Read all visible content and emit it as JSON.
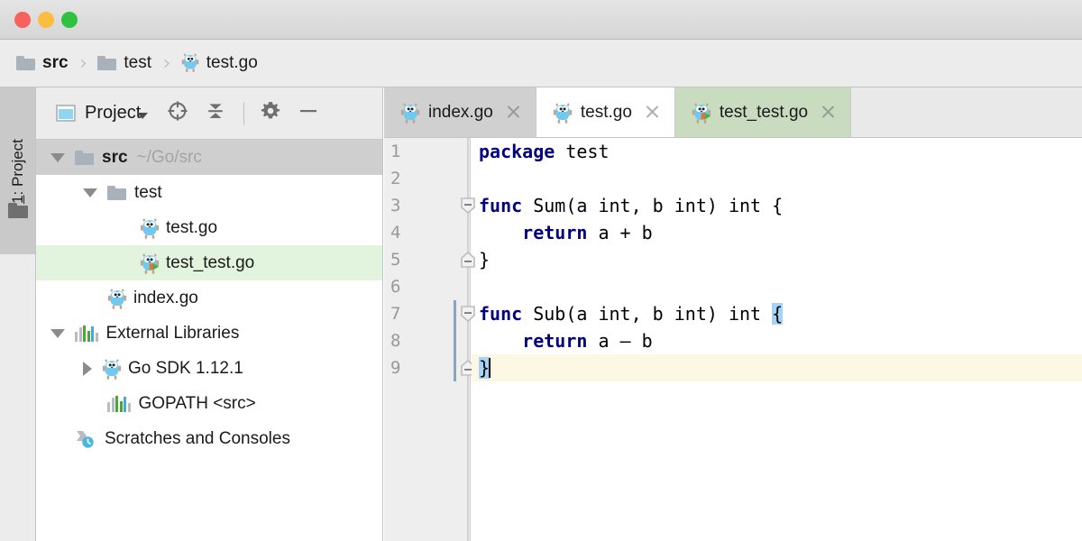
{
  "window": {
    "traffic_lights": [
      {
        "name": "close",
        "color": "#f9625c"
      },
      {
        "name": "minimize",
        "color": "#fcbc40"
      },
      {
        "name": "zoom",
        "color": "#2fc13f"
      }
    ]
  },
  "breadcrumb": {
    "items": [
      {
        "label": "src",
        "icon": "folder-icon",
        "bold": true
      },
      {
        "label": "test",
        "icon": "folder-icon",
        "bold": false
      },
      {
        "label": "test.go",
        "icon": "go-file-icon",
        "bold": false
      }
    ],
    "separator": "›"
  },
  "toolstrip": {
    "project_tab": {
      "number": "1",
      "label": "Project",
      "full": "1: Project"
    },
    "folder_icon": "folder-icon"
  },
  "project_panel": {
    "title": "Project",
    "title_icon": "project-view-icon",
    "caret": "chevron-down-icon",
    "tools": [
      {
        "name": "scroll-from-source-icon",
        "title": "Select Opened File"
      },
      {
        "name": "collapse-all-icon",
        "title": "Collapse All"
      },
      {
        "name": "settings-gear-icon",
        "title": "Settings"
      },
      {
        "name": "hide-panel-icon",
        "title": "Hide"
      }
    ],
    "tree": [
      {
        "label": "src",
        "secondary": "~/Go/src",
        "icon": "folder-icon",
        "twisty": "down",
        "indent": 0,
        "bold": true,
        "highlight": "gray"
      },
      {
        "label": "test",
        "secondary": "",
        "icon": "folder-icon",
        "twisty": "down",
        "indent": 1,
        "bold": false,
        "highlight": "none"
      },
      {
        "label": "test.go",
        "secondary": "",
        "icon": "go-file-icon",
        "twisty": "none",
        "indent": 2,
        "bold": false,
        "highlight": "none"
      },
      {
        "label": "test_test.go",
        "secondary": "",
        "icon": "go-test-file-icon",
        "twisty": "none",
        "indent": 2,
        "bold": false,
        "highlight": "green"
      },
      {
        "label": "index.go",
        "secondary": "",
        "icon": "go-file-icon",
        "twisty": "none",
        "indent": 1,
        "bold": false,
        "highlight": "none"
      },
      {
        "label": "External Libraries",
        "secondary": "",
        "icon": "libraries-icon",
        "twisty": "down",
        "indent": 0,
        "bold": false,
        "highlight": "none"
      },
      {
        "label": "Go SDK 1.12.1",
        "secondary": "",
        "icon": "go-file-icon",
        "twisty": "right",
        "indent": 1,
        "bold": false,
        "highlight": "none"
      },
      {
        "label": "GOPATH <src>",
        "secondary": "",
        "icon": "libraries-icon",
        "twisty": "none",
        "indent": 1,
        "bold": false,
        "highlight": "none"
      },
      {
        "label": "Scratches and Consoles",
        "secondary": "",
        "icon": "scratches-icon",
        "twisty": "none",
        "indent": 0,
        "bold": false,
        "highlight": "none"
      }
    ]
  },
  "editor": {
    "tabs": [
      {
        "label": "index.go",
        "icon": "go-file-icon",
        "state": "inactive",
        "closable": true
      },
      {
        "label": "test.go",
        "icon": "go-file-icon",
        "state": "active",
        "closable": true
      },
      {
        "label": "test_test.go",
        "icon": "go-test-file-icon",
        "state": "green",
        "closable": true
      }
    ],
    "line_numbers": [
      "1",
      "2",
      "3",
      "4",
      "5",
      "6",
      "7",
      "8",
      "9"
    ],
    "lines": [
      {
        "n": "1",
        "tokens": [
          {
            "t": "package",
            "k": true
          },
          {
            "t": " test",
            "k": false
          }
        ],
        "current": false
      },
      {
        "n": "2",
        "tokens": [
          {
            "t": "",
            "k": false
          }
        ],
        "current": false
      },
      {
        "n": "3",
        "tokens": [
          {
            "t": "func",
            "k": true
          },
          {
            "t": " Sum(a int, b int) int {",
            "k": false
          }
        ],
        "current": false
      },
      {
        "n": "4",
        "tokens": [
          {
            "t": "    ",
            "k": false
          },
          {
            "t": "return",
            "k": true
          },
          {
            "t": " a + b",
            "k": false
          }
        ],
        "current": false
      },
      {
        "n": "5",
        "tokens": [
          {
            "t": "}",
            "k": false
          }
        ],
        "current": false
      },
      {
        "n": "6",
        "tokens": [
          {
            "t": "",
            "k": false
          }
        ],
        "current": false
      },
      {
        "n": "7",
        "tokens": [
          {
            "t": "func",
            "k": true
          },
          {
            "t": " Sub(a int, b int) int ",
            "k": false
          }
        ],
        "current": false,
        "trailing_brace": "{"
      },
      {
        "n": "8",
        "tokens": [
          {
            "t": "    ",
            "k": false
          },
          {
            "t": "return",
            "k": true
          },
          {
            "t": " a – b",
            "k": false
          }
        ],
        "current": false
      },
      {
        "n": "9",
        "tokens": [],
        "current": true,
        "leading_brace": "}"
      }
    ],
    "caret": {
      "line": "9",
      "column": "2"
    },
    "fold_markers": [
      {
        "line": "3",
        "type": "fold-start"
      },
      {
        "line": "5",
        "type": "fold-end"
      },
      {
        "line": "7",
        "type": "fold-start"
      },
      {
        "line": "9",
        "type": "fold-end"
      }
    ],
    "colors": {
      "keyword": "#000080",
      "text": "#1a1a1a",
      "current_line": "#fdf8e4",
      "brace_match": "#a6d2f5",
      "gutter_bg": "#eeeeee",
      "line_number": "#999999",
      "block_indicator": "#8ca4bd"
    }
  }
}
